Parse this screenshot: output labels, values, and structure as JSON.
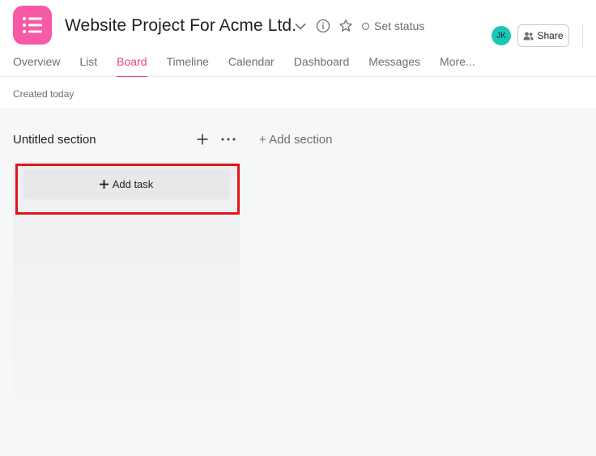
{
  "header": {
    "title": "Website Project For Acme Ltd.",
    "set_status_label": "Set status",
    "avatar_initials": "JK",
    "share_label": "Share"
  },
  "tabs": [
    {
      "label": "Overview"
    },
    {
      "label": "List"
    },
    {
      "label": "Board"
    },
    {
      "label": "Timeline"
    },
    {
      "label": "Calendar"
    },
    {
      "label": "Dashboard"
    },
    {
      "label": "Messages"
    },
    {
      "label": "More..."
    }
  ],
  "active_tab": "Board",
  "subbar": {
    "created_label": "Created today"
  },
  "board": {
    "section_title": "Untitled section",
    "add_section_label": "+ Add section",
    "add_task_label": "Add task"
  },
  "colors": {
    "app_icon": "#f75aa7",
    "accent": "#e8407f",
    "avatar": "#1ac7b6",
    "highlight": "#e0151c"
  },
  "icons": {
    "app": "list-icon",
    "title_dropdown": "chevron-down-icon",
    "info": "info-icon",
    "favorite": "star-icon",
    "status": "circle-icon",
    "share": "people-icon",
    "section_add": "plus-icon",
    "section_more": "more-icon",
    "add_task": "plus-icon"
  }
}
